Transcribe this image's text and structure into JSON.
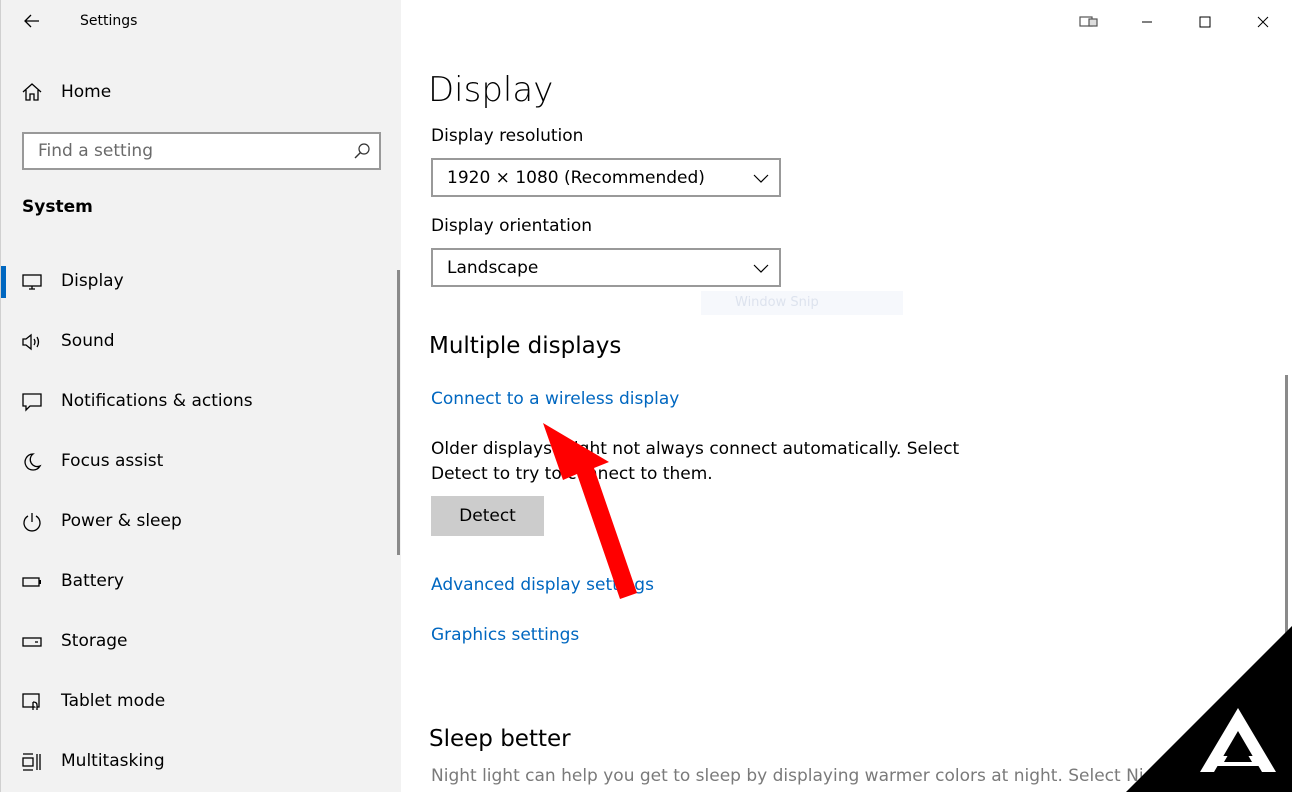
{
  "window": {
    "app_title": "Settings"
  },
  "sidebar": {
    "home_label": "Home",
    "search_placeholder": "Find a setting",
    "section_title": "System",
    "items": [
      {
        "label": "Display",
        "icon": "monitor-icon",
        "selected": true
      },
      {
        "label": "Sound",
        "icon": "speaker-icon"
      },
      {
        "label": "Notifications & actions",
        "icon": "notification-icon"
      },
      {
        "label": "Focus assist",
        "icon": "moon-icon"
      },
      {
        "label": "Power & sleep",
        "icon": "power-icon"
      },
      {
        "label": "Battery",
        "icon": "battery-icon"
      },
      {
        "label": "Storage",
        "icon": "storage-icon"
      },
      {
        "label": "Tablet mode",
        "icon": "tablet-mode-icon"
      },
      {
        "label": "Multitasking",
        "icon": "multitasking-icon"
      }
    ]
  },
  "main": {
    "title": "Display",
    "resolution": {
      "label": "Display resolution",
      "value": "1920 × 1080 (Recommended)"
    },
    "orientation": {
      "label": "Display orientation",
      "value": "Landscape"
    },
    "faint_overlay_text": "Window Snip",
    "multiple_displays": {
      "heading": "Multiple displays",
      "wireless_link": "Connect to a wireless display",
      "description_line1": "Older displays might not always connect automatically. Select",
      "description_line2": "Detect to try to connect to them.",
      "detect_button": "Detect",
      "advanced_link": "Advanced display settings",
      "graphics_link": "Graphics settings"
    },
    "sleep_better": {
      "heading": "Sleep better",
      "description": "Night light can help you get to sleep by displaying warmer colors at night. Select Night light"
    }
  },
  "colors": {
    "accent": "#0067c0",
    "sidebar_bg": "#f2f2f2",
    "button_bg": "#cccccc",
    "arrow": "#ff0000"
  }
}
